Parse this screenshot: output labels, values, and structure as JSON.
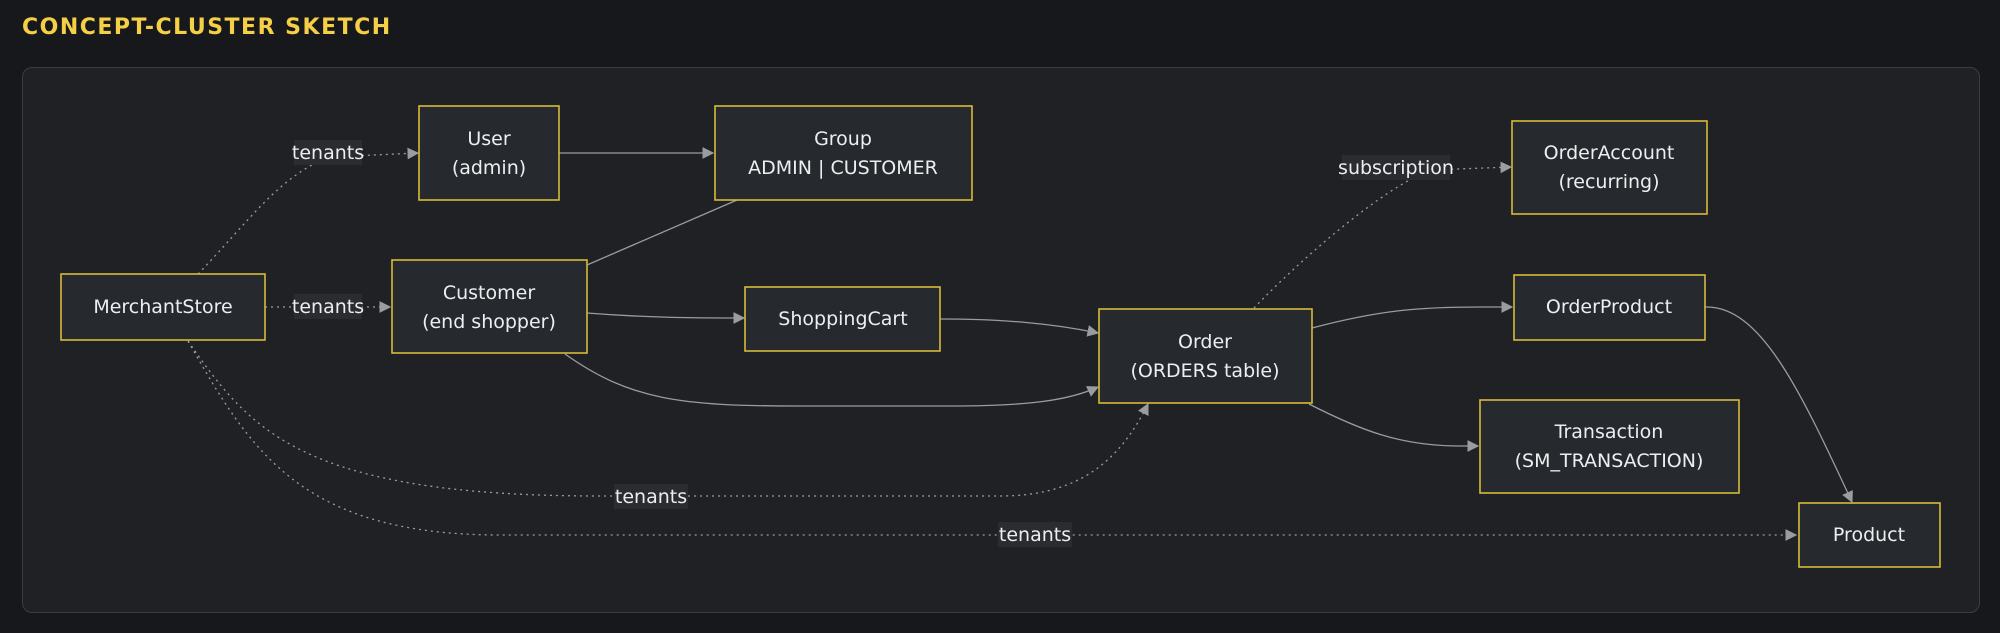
{
  "title": "CONCEPT-CLUSTER SKETCH",
  "nodes": {
    "merchantstore": {
      "line1": "MerchantStore",
      "line2": ""
    },
    "user": {
      "line1": "User",
      "line2": "(admin)"
    },
    "group": {
      "line1": "Group",
      "line2": "ADMIN | CUSTOMER"
    },
    "customer": {
      "line1": "Customer",
      "line2": "(end shopper)"
    },
    "shoppingcart": {
      "line1": "ShoppingCart",
      "line2": ""
    },
    "order": {
      "line1": "Order",
      "line2": "(ORDERS table)"
    },
    "orderaccount": {
      "line1": "OrderAccount",
      "line2": "(recurring)"
    },
    "orderproduct": {
      "line1": "OrderProduct",
      "line2": ""
    },
    "transaction": {
      "line1": "Transaction",
      "line2": "(SM_TRANSACTION)"
    },
    "product": {
      "line1": "Product",
      "line2": ""
    }
  },
  "edge_labels": {
    "tenants_user": "tenants",
    "tenants_customer": "tenants",
    "tenants_order": "tenants",
    "tenants_product": "tenants",
    "subscription": "subscription"
  },
  "edges": [
    {
      "from": "MerchantStore",
      "to": "User",
      "label": "tenants",
      "style": "dotted"
    },
    {
      "from": "MerchantStore",
      "to": "Customer",
      "label": "tenants",
      "style": "dotted"
    },
    {
      "from": "MerchantStore",
      "to": "Order",
      "label": "tenants",
      "style": "dotted"
    },
    {
      "from": "MerchantStore",
      "to": "Product",
      "label": "tenants",
      "style": "dotted"
    },
    {
      "from": "User",
      "to": "Group",
      "style": "solid"
    },
    {
      "from": "Customer",
      "to": "Group",
      "style": "solid"
    },
    {
      "from": "Customer",
      "to": "ShoppingCart",
      "style": "solid"
    },
    {
      "from": "Customer",
      "to": "Order",
      "style": "solid"
    },
    {
      "from": "ShoppingCart",
      "to": "Order",
      "style": "solid"
    },
    {
      "from": "Order",
      "to": "OrderAccount",
      "label": "subscription",
      "style": "dotted"
    },
    {
      "from": "Order",
      "to": "OrderProduct",
      "style": "solid"
    },
    {
      "from": "Order",
      "to": "Transaction",
      "style": "solid"
    },
    {
      "from": "OrderProduct",
      "to": "Product",
      "style": "solid"
    }
  ]
}
